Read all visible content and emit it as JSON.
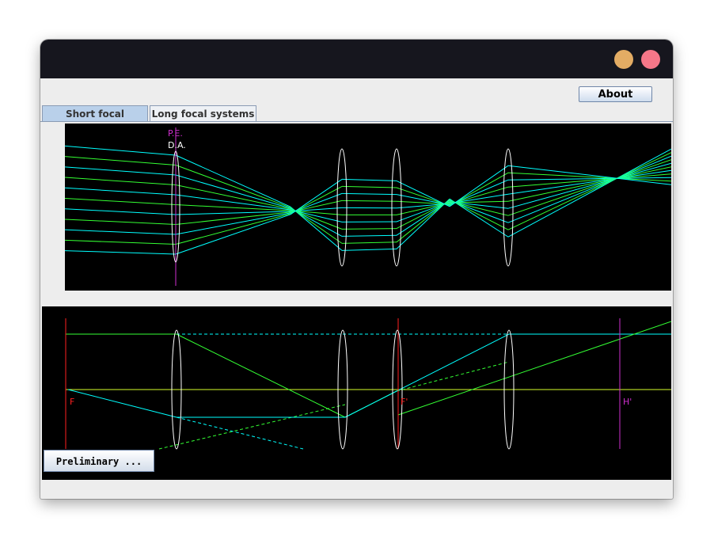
{
  "window": {
    "close_color": "#f67789",
    "minimize_color": "#e3ac64"
  },
  "toolbar": {
    "about_label": "About"
  },
  "tabs": [
    {
      "label": "Short focal systems",
      "selected": true
    },
    {
      "label": "Long focal systems",
      "selected": false
    }
  ],
  "top_diagram": {
    "labels": {
      "pe": "P.E.",
      "da": "D.A."
    },
    "colors": {
      "pe": "#d12fd1",
      "lens": "#ffffff",
      "ray_a": "#00ffff",
      "ray_b": "#33ff33"
    }
  },
  "bottom_diagram": {
    "labels": {
      "f": "F",
      "f_prime": "F'",
      "h_prime": "H'"
    },
    "colors": {
      "focal": "#ff2020",
      "principal": "#d12fd1",
      "axis": "#d8ff2a"
    }
  },
  "footer": {
    "preliminary_label": "Preliminary ..."
  }
}
